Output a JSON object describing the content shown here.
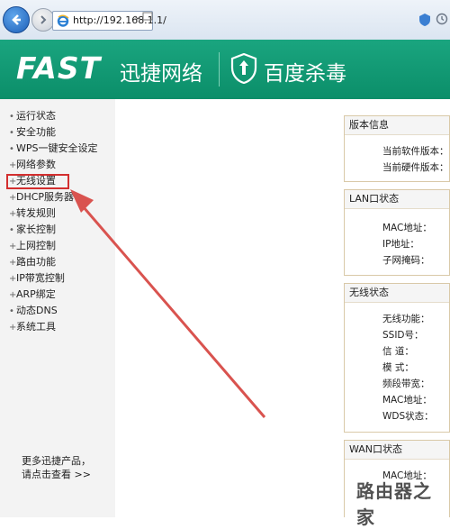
{
  "browser": {
    "url": "http://192.168.1.1/",
    "icons": [
      "back-arrow-icon",
      "forward-arrow-icon",
      "ie-favicon",
      "compatibility-icon",
      "history-icon"
    ]
  },
  "banner": {
    "brand": "FAST",
    "brand_cn": "迅捷网络",
    "antivirus": "百度杀毒"
  },
  "sidebar": {
    "items": [
      {
        "label": "运行状态"
      },
      {
        "label": "安全功能"
      },
      {
        "label": "WPS一键安全设定"
      },
      {
        "label": "网络参数"
      },
      {
        "label": "无线设置"
      },
      {
        "label": "DHCP服务器"
      },
      {
        "label": "转发规则"
      },
      {
        "label": "家长控制"
      },
      {
        "label": "上网控制"
      },
      {
        "label": "路由功能"
      },
      {
        "label": "IP带宽控制"
      },
      {
        "label": "ARP绑定"
      },
      {
        "label": "动态DNS"
      },
      {
        "label": "系统工具"
      }
    ],
    "more_line1": "更多迅捷产品，",
    "more_line2": "请点击查看 >>"
  },
  "panels": {
    "version": {
      "title": "版本信息",
      "software": "当前软件版本：",
      "hardware": "当前硬件版本："
    },
    "lan": {
      "title": "LAN口状态",
      "mac": "MAC地址：",
      "ip": "IP地址：",
      "mask": "子网掩码："
    },
    "wireless": {
      "title": "无线状态",
      "func": "无线功能：",
      "ssid": "SSID号：",
      "channel": "信 道：",
      "mode": "模 式：",
      "bandwidth": "频段带宽：",
      "mac": "MAC地址：",
      "wds": "WDS状态："
    },
    "wan": {
      "title": "WAN口状态",
      "mac": "MAC地址："
    }
  },
  "watermark": "路由器之家",
  "colors": {
    "banner": "#0b8e69",
    "highlight": "#d32f2f",
    "arrow": "#d9534f"
  }
}
